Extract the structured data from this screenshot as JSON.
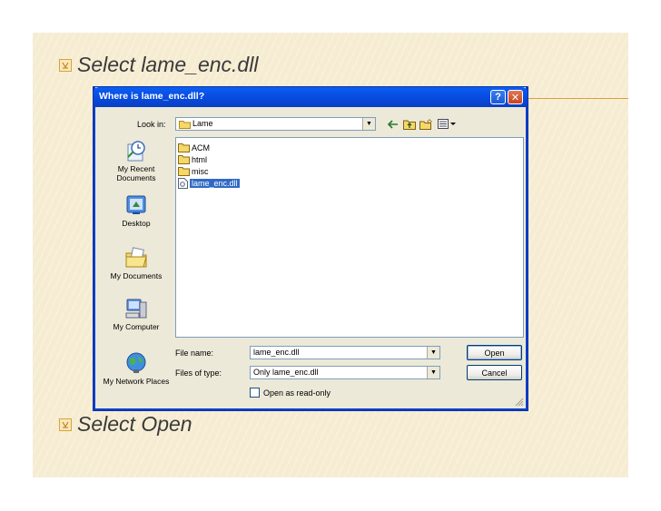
{
  "slide": {
    "bullet1": "Select lame_enc.dll",
    "bullet2": "Select Open"
  },
  "dialog": {
    "title": "Where is lame_enc.dll?",
    "help_glyph": "?",
    "close_glyph": "✕",
    "look_in_label": "Look in:",
    "look_in_value": "Lame",
    "places": [
      {
        "label": "My Recent Documents",
        "icon": "recent-documents-icon"
      },
      {
        "label": "Desktop",
        "icon": "desktop-icon"
      },
      {
        "label": "My Documents",
        "icon": "my-documents-icon"
      },
      {
        "label": "My Computer",
        "icon": "my-computer-icon"
      },
      {
        "label": "My Network Places",
        "icon": "network-places-icon"
      }
    ],
    "files": [
      {
        "name": "ACM",
        "type": "folder"
      },
      {
        "name": "html",
        "type": "folder"
      },
      {
        "name": "misc",
        "type": "folder"
      },
      {
        "name": "lame_enc.dll",
        "type": "dll",
        "selected": true
      }
    ],
    "file_name_label": "File name:",
    "file_name_value": "lame_enc.dll",
    "files_of_type_label": "Files of type:",
    "files_of_type_value": "Only lame_enc.dll",
    "open_readonly_label": "Open as read-only",
    "open_button": "Open",
    "cancel_button": "Cancel"
  },
  "colors": {
    "title_bar": "#0a4fe3",
    "selection": "#316ac5",
    "accent": "#d9a33a"
  }
}
